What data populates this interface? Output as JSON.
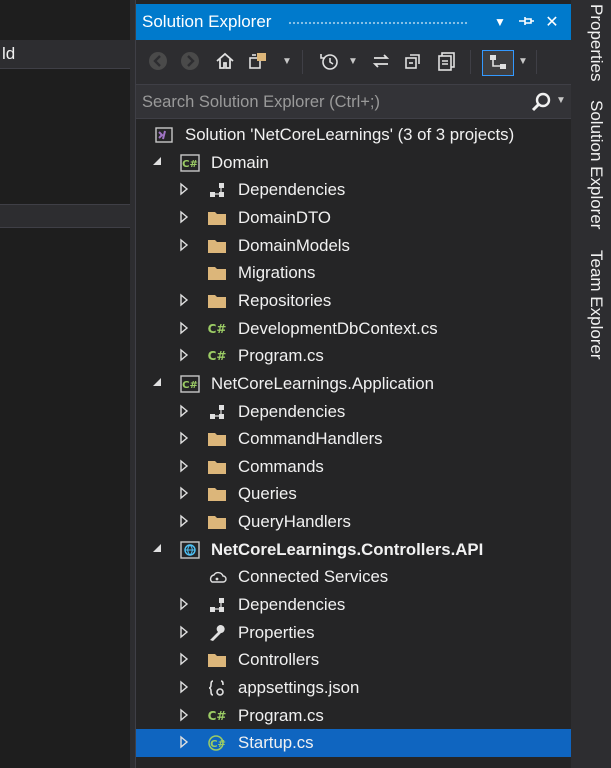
{
  "left_editor": {
    "tab_text": "ld"
  },
  "panel": {
    "title": "Solution Explorer",
    "title_buttons": [
      "▼",
      "⊣",
      "✕"
    ],
    "search": {
      "placeholder": "Search Solution Explorer (Ctrl+;)"
    }
  },
  "toolbar": {
    "tools": [
      {
        "name": "back-icon",
        "glyph": "◀",
        "disabled": true
      },
      {
        "name": "forward-icon",
        "glyph": "▶",
        "disabled": true
      },
      {
        "name": "home-icon",
        "glyph": "⌂"
      },
      {
        "name": "switch-views-icon",
        "glyph": "⧉"
      },
      {
        "name": "pending-changes-filter-icon",
        "glyph": "◷"
      },
      {
        "name": "sync-icon",
        "glyph": "⇆"
      },
      {
        "name": "collapse-all-icon",
        "glyph": "⧉"
      },
      {
        "name": "show-all-files-icon",
        "glyph": "▣"
      },
      {
        "name": "sync-with-active-document-icon",
        "glyph": "⊞"
      }
    ]
  },
  "tree": [
    {
      "label": "Solution 'NetCoreLearnings' (3 of 3 projects)",
      "icon": "solution",
      "level": 0,
      "expander": "none"
    },
    {
      "label": "Domain",
      "icon": "csproj",
      "level": 0,
      "expander": "open"
    },
    {
      "label": "Dependencies",
      "icon": "dependencies",
      "level": 1,
      "expander": "closed"
    },
    {
      "label": "DomainDTO",
      "icon": "folder",
      "level": 1,
      "expander": "closed"
    },
    {
      "label": "DomainModels",
      "icon": "folder",
      "level": 1,
      "expander": "closed"
    },
    {
      "label": "Migrations",
      "icon": "folder",
      "level": 1,
      "expander": "none"
    },
    {
      "label": "Repositories",
      "icon": "folder",
      "level": 1,
      "expander": "closed"
    },
    {
      "label": "DevelopmentDbContext.cs",
      "icon": "csfile",
      "level": 1,
      "expander": "closed"
    },
    {
      "label": "Program.cs",
      "icon": "csfile",
      "level": 1,
      "expander": "closed"
    },
    {
      "label": "NetCoreLearnings.Application",
      "icon": "csproj",
      "level": 0,
      "expander": "open"
    },
    {
      "label": "Dependencies",
      "icon": "dependencies",
      "level": 1,
      "expander": "closed"
    },
    {
      "label": "CommandHandlers",
      "icon": "folder",
      "level": 1,
      "expander": "closed"
    },
    {
      "label": "Commands",
      "icon": "folder",
      "level": 1,
      "expander": "closed"
    },
    {
      "label": "Queries",
      "icon": "folder",
      "level": 1,
      "expander": "closed"
    },
    {
      "label": "QueryHandlers",
      "icon": "folder",
      "level": 1,
      "expander": "closed"
    },
    {
      "label": "NetCoreLearnings.Controllers.API",
      "icon": "webproj",
      "level": 0,
      "expander": "open",
      "bold": true
    },
    {
      "label": "Connected Services",
      "icon": "connected",
      "level": 1,
      "expander": "none"
    },
    {
      "label": "Dependencies",
      "icon": "dependencies",
      "level": 1,
      "expander": "closed"
    },
    {
      "label": "Properties",
      "icon": "wrench",
      "level": 1,
      "expander": "closed"
    },
    {
      "label": "Controllers",
      "icon": "folder",
      "level": 1,
      "expander": "closed"
    },
    {
      "label": "appsettings.json",
      "icon": "json",
      "level": 1,
      "expander": "closed"
    },
    {
      "label": "Program.cs",
      "icon": "csfile",
      "level": 1,
      "expander": "closed"
    },
    {
      "label": "Startup.cs",
      "icon": "csfile-selected",
      "level": 1,
      "expander": "closed",
      "selected": true
    }
  ],
  "side_tabs": [
    "Properties",
    "Solution Explorer",
    "Team Explorer"
  ],
  "colors": {
    "accent": "#007acc",
    "selection": "#0f65c0",
    "folder": "#dcb67a",
    "csharp": "#9ccc65"
  }
}
